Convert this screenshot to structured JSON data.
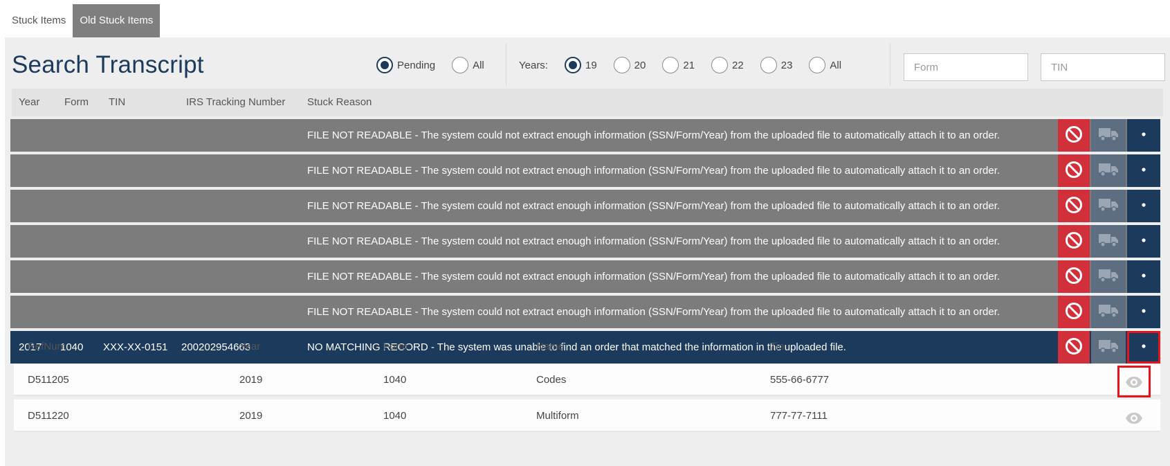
{
  "tabs": [
    {
      "label": "Stuck Items",
      "active": false
    },
    {
      "label": "Old Stuck Items",
      "active": true
    }
  ],
  "page_title": "Search Transcript",
  "status_filter": {
    "options": [
      "Pending",
      "All"
    ],
    "selected": "Pending"
  },
  "years_filter": {
    "label": "Years:",
    "options": [
      "19",
      "20",
      "21",
      "22",
      "23",
      "All"
    ],
    "selected": "19"
  },
  "inputs": {
    "form_placeholder": "Form",
    "tin_placeholder": "TIN"
  },
  "table": {
    "columns": [
      "Year",
      "Form",
      "TIN",
      "IRS Tracking Number",
      "Stuck Reason"
    ],
    "rows": [
      {
        "year": "",
        "form": "",
        "tin": "",
        "tracking": "",
        "reason": "FILE NOT READABLE - The system could not extract enough information (SSN/Form/Year) from the uploaded file to automatically attach it to an order.",
        "selected": false
      },
      {
        "year": "",
        "form": "",
        "tin": "",
        "tracking": "",
        "reason": "FILE NOT READABLE - The system could not extract enough information (SSN/Form/Year) from the uploaded file to automatically attach it to an order.",
        "selected": false
      },
      {
        "year": "",
        "form": "",
        "tin": "",
        "tracking": "",
        "reason": "FILE NOT READABLE - The system could not extract enough information (SSN/Form/Year) from the uploaded file to automatically attach it to an order.",
        "selected": false
      },
      {
        "year": "",
        "form": "",
        "tin": "",
        "tracking": "",
        "reason": "FILE NOT READABLE - The system could not extract enough information (SSN/Form/Year) from the uploaded file to automatically attach it to an order.",
        "selected": false
      },
      {
        "year": "",
        "form": "",
        "tin": "",
        "tracking": "",
        "reason": "FILE NOT READABLE - The system could not extract enough information (SSN/Form/Year) from the uploaded file to automatically attach it to an order.",
        "selected": false
      },
      {
        "year": "",
        "form": "",
        "tin": "",
        "tracking": "",
        "reason": "FILE NOT READABLE - The system could not extract enough information (SSN/Form/Year) from the uploaded file to automatically attach it to an order.",
        "selected": false
      },
      {
        "year": "2017",
        "form": "1040",
        "tin": "XXX-XX-0151",
        "tracking": "200202954663",
        "reason": "NO MATCHING RECORD - The system was unable to find an order that matched the information in the uploaded file.",
        "selected": true
      }
    ],
    "row_actions": [
      "ban-icon",
      "truck-icon",
      "eye-icon"
    ]
  },
  "matches": {
    "columns": [
      "RefNum",
      "Year",
      "Form",
      "Name",
      "Tin"
    ],
    "rows": [
      {
        "refnum": "D511205",
        "year": "2019",
        "form": "1040",
        "name": "Codes",
        "tin": "555-66-6777"
      },
      {
        "refnum": "D511220",
        "year": "2019",
        "form": "1040",
        "name": "Multiform",
        "tin": "777-77-7111"
      }
    ]
  },
  "colors": {
    "navy": "#1b3a5c",
    "gray_row": "#7c7c7c",
    "danger": "#d1303a",
    "truck": "#5d6e80",
    "highlight": "#e4141d"
  }
}
